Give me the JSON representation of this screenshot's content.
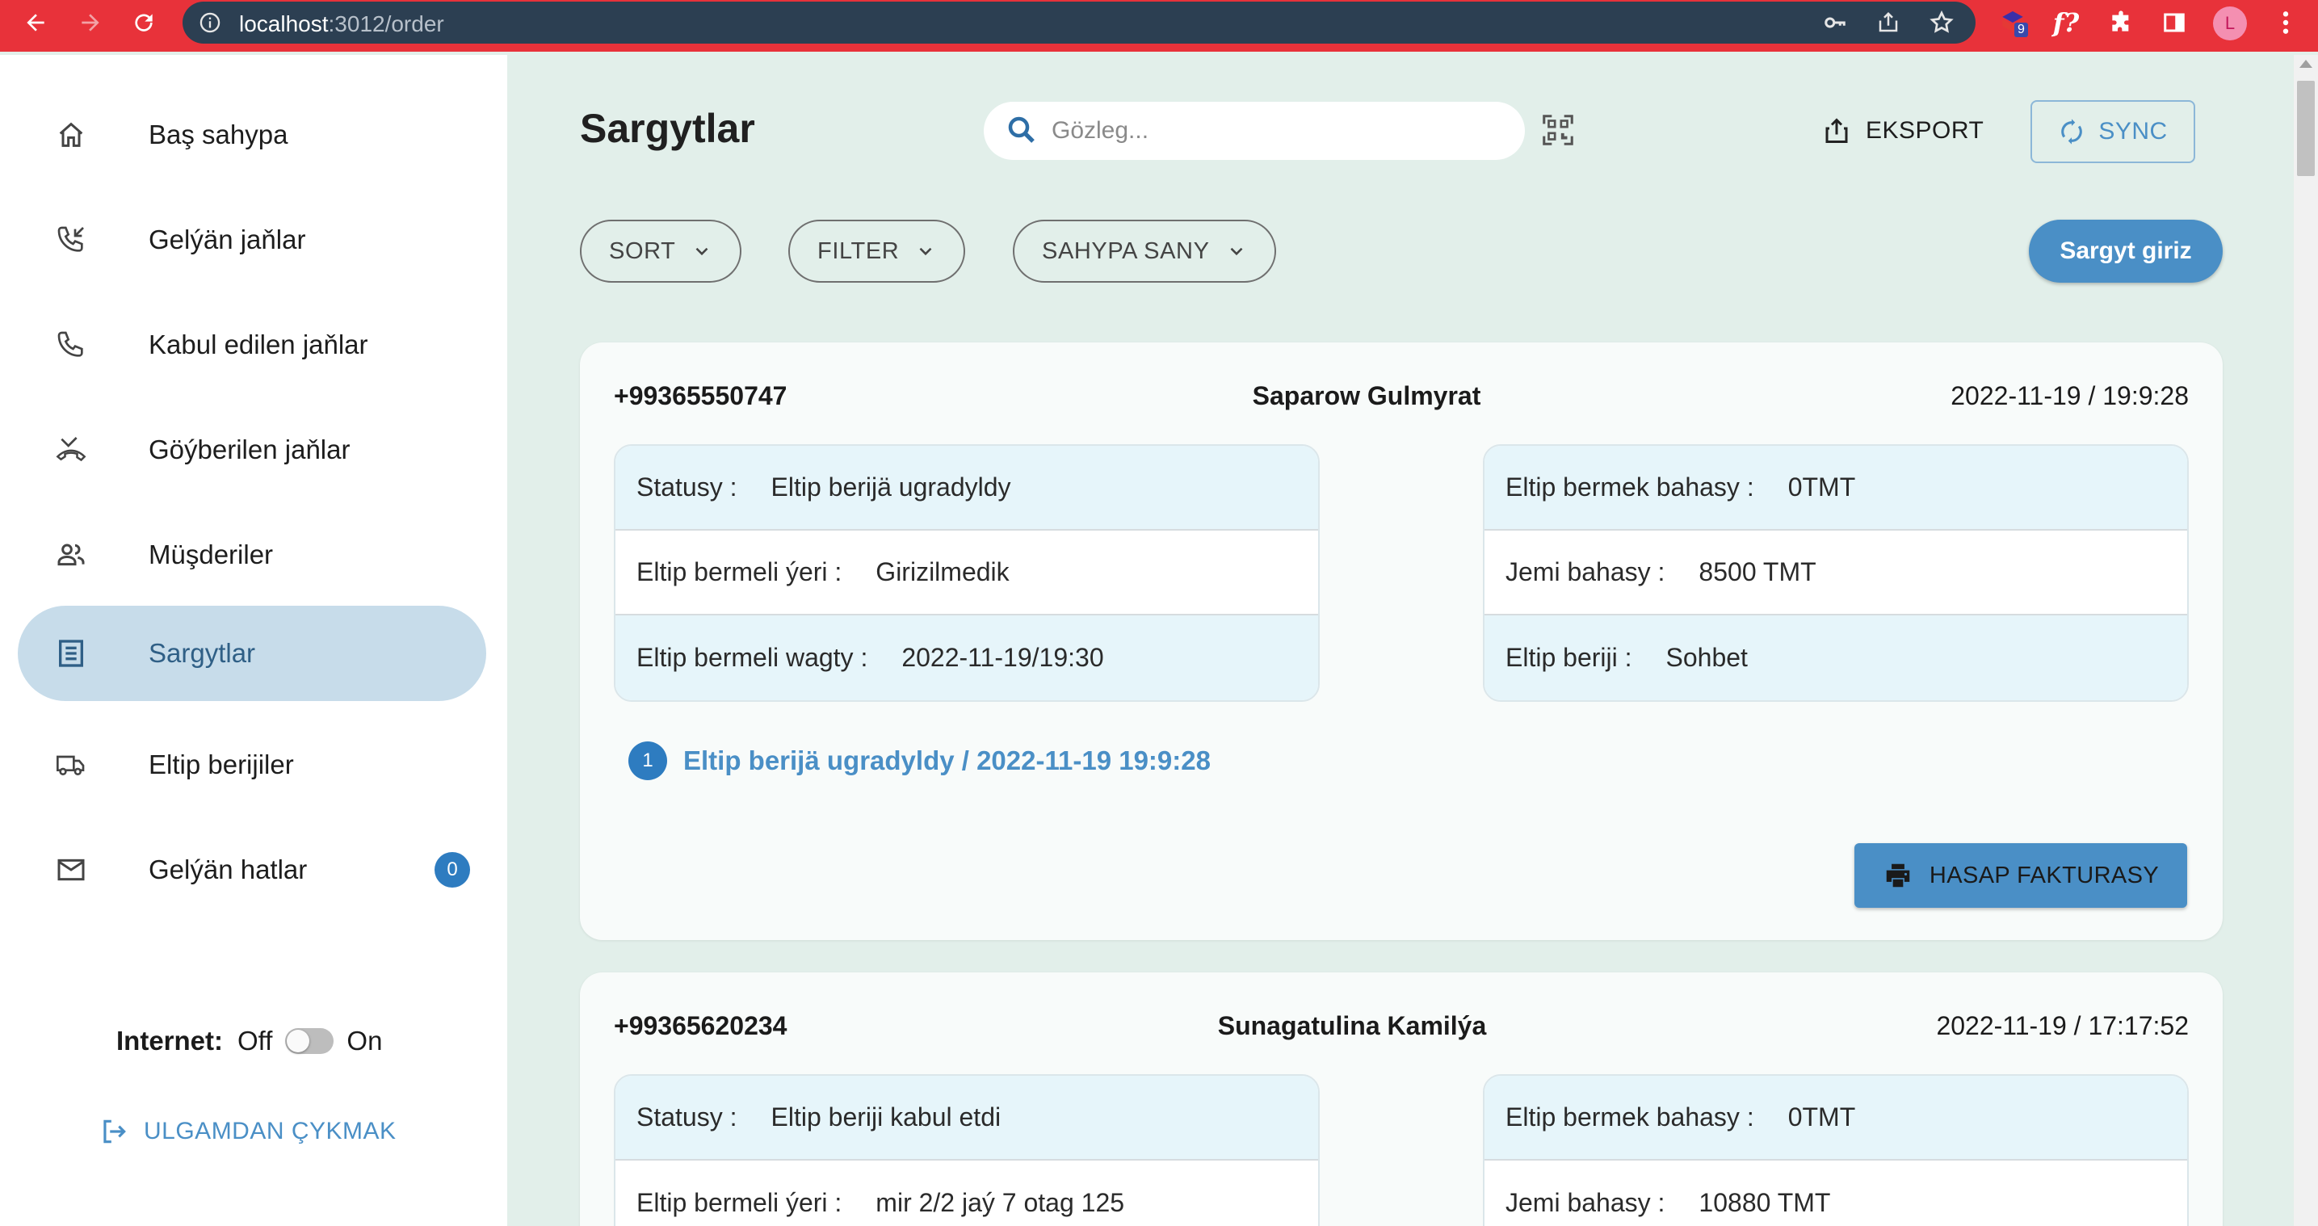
{
  "browser": {
    "url_host": "localhost",
    "url_rest": ":3012/order",
    "profile_initial": "L",
    "ext_badge": "9",
    "fx_label": "f?"
  },
  "sidebar": {
    "items": [
      {
        "label": "Baş sahypa",
        "icon": "home-icon"
      },
      {
        "label": "Gelýän jaňlar",
        "icon": "incoming-call-icon"
      },
      {
        "label": "Kabul edilen jaňlar",
        "icon": "phone-icon"
      },
      {
        "label": "Göýberilen jaňlar",
        "icon": "missed-call-icon"
      },
      {
        "label": "Müşderiler",
        "icon": "people-icon"
      },
      {
        "label": "Sargytlar",
        "icon": "list-icon",
        "active": true
      },
      {
        "label": "Eltip berijiler",
        "icon": "truck-icon"
      },
      {
        "label": "Gelýän hatlar",
        "icon": "mail-icon",
        "badge": "0"
      }
    ],
    "internet": {
      "label": "Internet:",
      "off": "Off",
      "on": "On"
    },
    "logout": "ULGAMDAN ÇYKMAK"
  },
  "header": {
    "title": "Sargytlar",
    "search_placeholder": "Gözleg...",
    "export": "EKSPORT",
    "sync": "SYNC"
  },
  "toolbar": {
    "sort": "SORT",
    "filter": "FILTER",
    "page_size": "SAHYPA SANY",
    "new_order": "Sargyt giriz"
  },
  "orders": [
    {
      "phone": "+99365550747",
      "name": "Saparow Gulmyrat",
      "date": "2022-11-19 / 19:9:28",
      "left": [
        {
          "k": "Statusy :",
          "v": "Eltip berijä ugradyldy"
        },
        {
          "k": "Eltip bermeli ýeri :",
          "v": "Girizilmedik"
        },
        {
          "k": "Eltip bermeli wagty :",
          "v": "2022-11-19/19:30"
        }
      ],
      "right": [
        {
          "k": "Eltip bermek bahasy :",
          "v": "0TMT"
        },
        {
          "k": "Jemi bahasy :",
          "v": "8500 TMT"
        },
        {
          "k": "Eltip beriji :",
          "v": "Sohbet"
        }
      ],
      "step_num": "1",
      "step_text": "Eltip berijä ugradyldy / 2022-11-19 19:9:28",
      "invoice": "HASAP FAKTURASY"
    },
    {
      "phone": "+99365620234",
      "name": "Sunagatulina Kamilýa",
      "date": "2022-11-19 / 17:17:52",
      "left": [
        {
          "k": "Statusy :",
          "v": "Eltip beriji kabul etdi"
        },
        {
          "k": "Eltip bermeli ýeri :",
          "v": "mir 2/2 jaý 7 otag 125"
        }
      ],
      "right": [
        {
          "k": "Eltip bermek bahasy :",
          "v": "0TMT"
        },
        {
          "k": "Jemi bahasy :",
          "v": "10880 TMT"
        }
      ]
    }
  ]
}
